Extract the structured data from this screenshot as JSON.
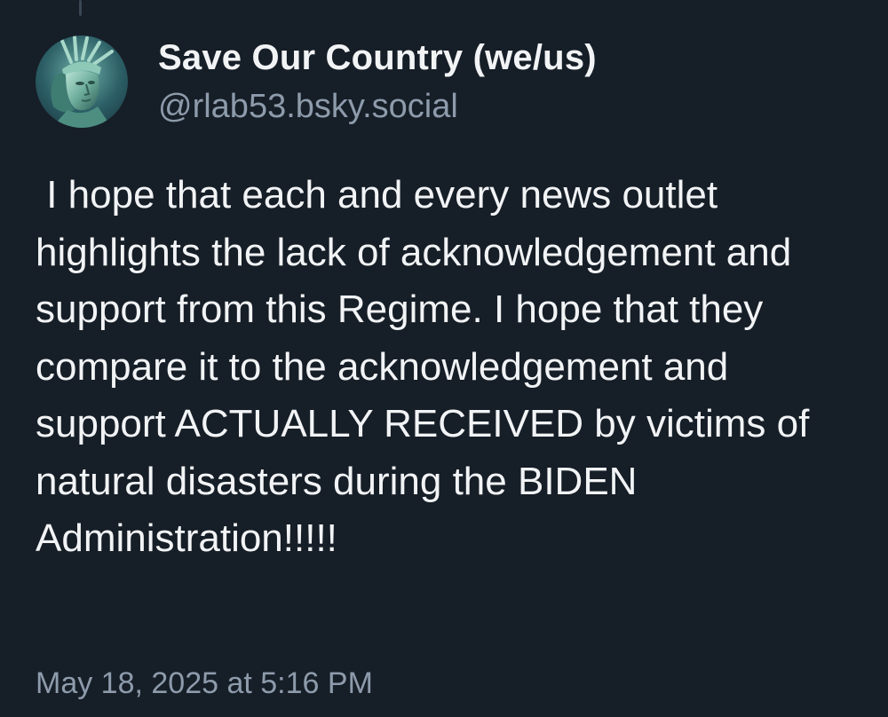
{
  "post": {
    "author": {
      "display_name": "Save Our Country (we/us)",
      "handle": "@rlab53.bsky.social",
      "avatar_icon": "statue-of-liberty-avatar"
    },
    "text": " I hope that each and every news outlet highlights the lack of acknowledgement and support from this Regime. I hope that they compare it to the acknowledgement and support ACTUALLY RECEIVED by victims of natural disasters during the BIDEN Administration!!!!!",
    "timestamp": "May 18, 2025 at 5:16 PM"
  },
  "colors": {
    "background": "#161e27",
    "primary_text": "#f1f3f5",
    "secondary_text": "#8d9bab",
    "thread_line": "#3a4654"
  }
}
